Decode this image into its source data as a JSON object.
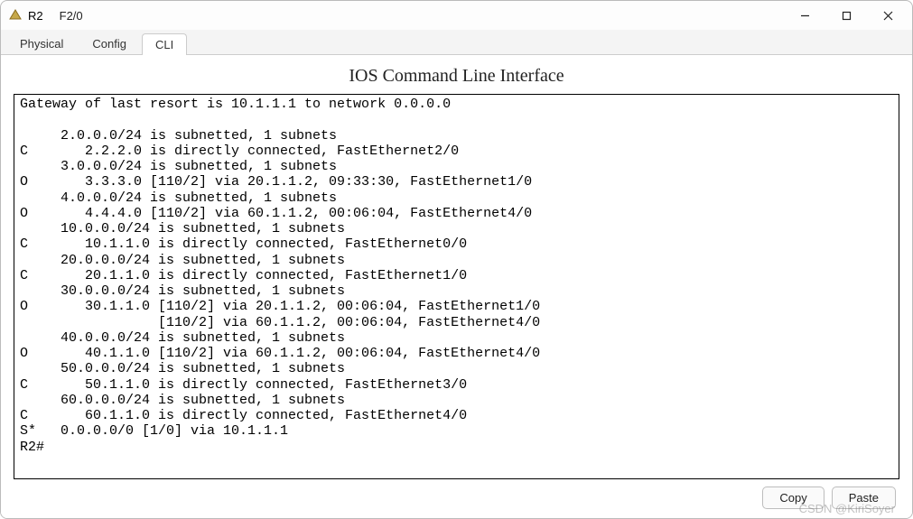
{
  "window": {
    "title": "R2",
    "interface": "F2/0"
  },
  "tabs": {
    "physical": "Physical",
    "config": "Config",
    "cli": "CLI"
  },
  "cli": {
    "header": "IOS Command Line Interface",
    "lines": [
      "Gateway of last resort is 10.1.1.1 to network 0.0.0.0",
      "",
      "     2.0.0.0/24 is subnetted, 1 subnets",
      "C       2.2.2.0 is directly connected, FastEthernet2/0",
      "     3.0.0.0/24 is subnetted, 1 subnets",
      "O       3.3.3.0 [110/2] via 20.1.1.2, 09:33:30, FastEthernet1/0",
      "     4.0.0.0/24 is subnetted, 1 subnets",
      "O       4.4.4.0 [110/2] via 60.1.1.2, 00:06:04, FastEthernet4/0",
      "     10.0.0.0/24 is subnetted, 1 subnets",
      "C       10.1.1.0 is directly connected, FastEthernet0/0",
      "     20.0.0.0/24 is subnetted, 1 subnets",
      "C       20.1.1.0 is directly connected, FastEthernet1/0",
      "     30.0.0.0/24 is subnetted, 1 subnets",
      "O       30.1.1.0 [110/2] via 20.1.1.2, 00:06:04, FastEthernet1/0",
      "                 [110/2] via 60.1.1.2, 00:06:04, FastEthernet4/0",
      "     40.0.0.0/24 is subnetted, 1 subnets",
      "O       40.1.1.0 [110/2] via 60.1.1.2, 00:06:04, FastEthernet4/0",
      "     50.0.0.0/24 is subnetted, 1 subnets",
      "C       50.1.1.0 is directly connected, FastEthernet3/0",
      "     60.0.0.0/24 is subnetted, 1 subnets",
      "C       60.1.1.0 is directly connected, FastEthernet4/0",
      "S*   0.0.0.0/0 [1/0] via 10.1.1.1",
      "R2#"
    ]
  },
  "buttons": {
    "copy": "Copy",
    "paste": "Paste"
  },
  "watermark": "CSDN @KiriSoyer"
}
